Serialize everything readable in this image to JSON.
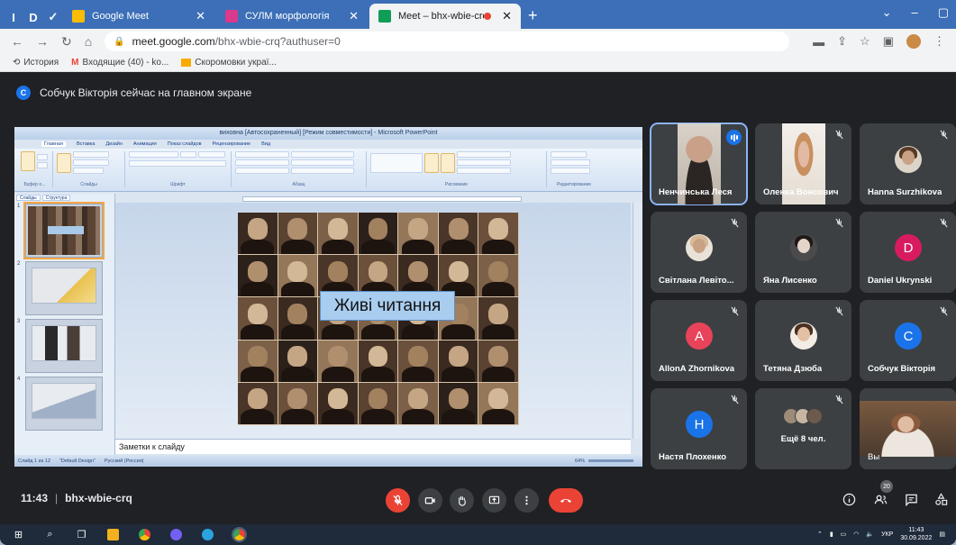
{
  "browser": {
    "pinned_tabs": [
      "I",
      "D",
      "✓"
    ],
    "tabs": [
      {
        "title": "Google Meet",
        "favicon_color": "#fbbc04",
        "active": false
      },
      {
        "title": "СУЛМ морфологія",
        "favicon_color": "#d93a8c",
        "active": false
      },
      {
        "title": "Meet – bhx-wbie-crq",
        "favicon_color": "#0f9d58",
        "active": true,
        "recording": true
      }
    ],
    "new_tab": "+",
    "url_host": "meet.google.com",
    "url_path": "/bhx-wbie-crq?authuser=0",
    "bookmarks": [
      {
        "label": "История",
        "icon": "history-icon"
      },
      {
        "label": "Входящие (40) - ko...",
        "icon": "gmail-icon"
      },
      {
        "label": "Скоромовки украї...",
        "icon": "bookmark-folder-icon"
      }
    ]
  },
  "meet": {
    "presenting_avatar": "C",
    "presenting_text": "Собчук Вікторія сейчас на главном экране",
    "time": "11:43",
    "meeting_code": "bhx-wbie-crq",
    "participant_badge": "20",
    "participants": [
      {
        "name": "Ненчинська Леся",
        "kind": "video",
        "speaking": true
      },
      {
        "name": "Оленка Вонсович",
        "kind": "video",
        "muted": true
      },
      {
        "name": "Hanna Surzhikova",
        "kind": "photo",
        "muted": true
      },
      {
        "name": "Світлана Левіто...",
        "kind": "photo",
        "muted": true
      },
      {
        "name": "Яна Лисенко",
        "kind": "photo",
        "muted": true
      },
      {
        "name": "Daniel Ukrynski",
        "kind": "letter",
        "letter": "D",
        "color": "#d81b60",
        "muted": true
      },
      {
        "name": "AllonA Zhornikova",
        "kind": "letter",
        "letter": "A",
        "color": "#e8435a",
        "muted": true
      },
      {
        "name": "Тетяна Дзюба",
        "kind": "photo",
        "muted": true
      },
      {
        "name": "Собчук Вікторія",
        "kind": "letter",
        "letter": "C",
        "color": "#1a73e8",
        "muted": true
      },
      {
        "name": "Настя Плохенко",
        "kind": "letter",
        "letter": "H",
        "color": "#1a73e8",
        "muted": true
      },
      {
        "name": "Ещё 8 чел.",
        "kind": "more"
      },
      {
        "name": "Вы",
        "kind": "self"
      }
    ]
  },
  "powerpoint": {
    "window_title": "виховна [Автосохраненный] [Режим совместимости] - Microsoft PowerPoint",
    "ribbon_tabs": [
      "Главная",
      "Вставка",
      "Дизайн",
      "Анимация",
      "Показ слайдов",
      "Рецензирование",
      "Вид"
    ],
    "group_labels": [
      "Буфер о...",
      "Слайды",
      "Шрифт",
      "Абзац",
      "Рисование",
      "Редактирование"
    ],
    "left_tabs": [
      "Слайды",
      "Структура"
    ],
    "slide_numbers": [
      "1",
      "2",
      "3",
      "4"
    ],
    "slide_title": "Живі читання",
    "notes_placeholder": "Заметки к слайду",
    "status_slide": "Слайд 1 из 12",
    "status_theme": "\"Default Design\"",
    "status_lang": "Русский (Россия)",
    "zoom": "64%"
  },
  "taskbar": {
    "lang": "УКР",
    "time": "11:43",
    "date": "30.09.2022"
  }
}
